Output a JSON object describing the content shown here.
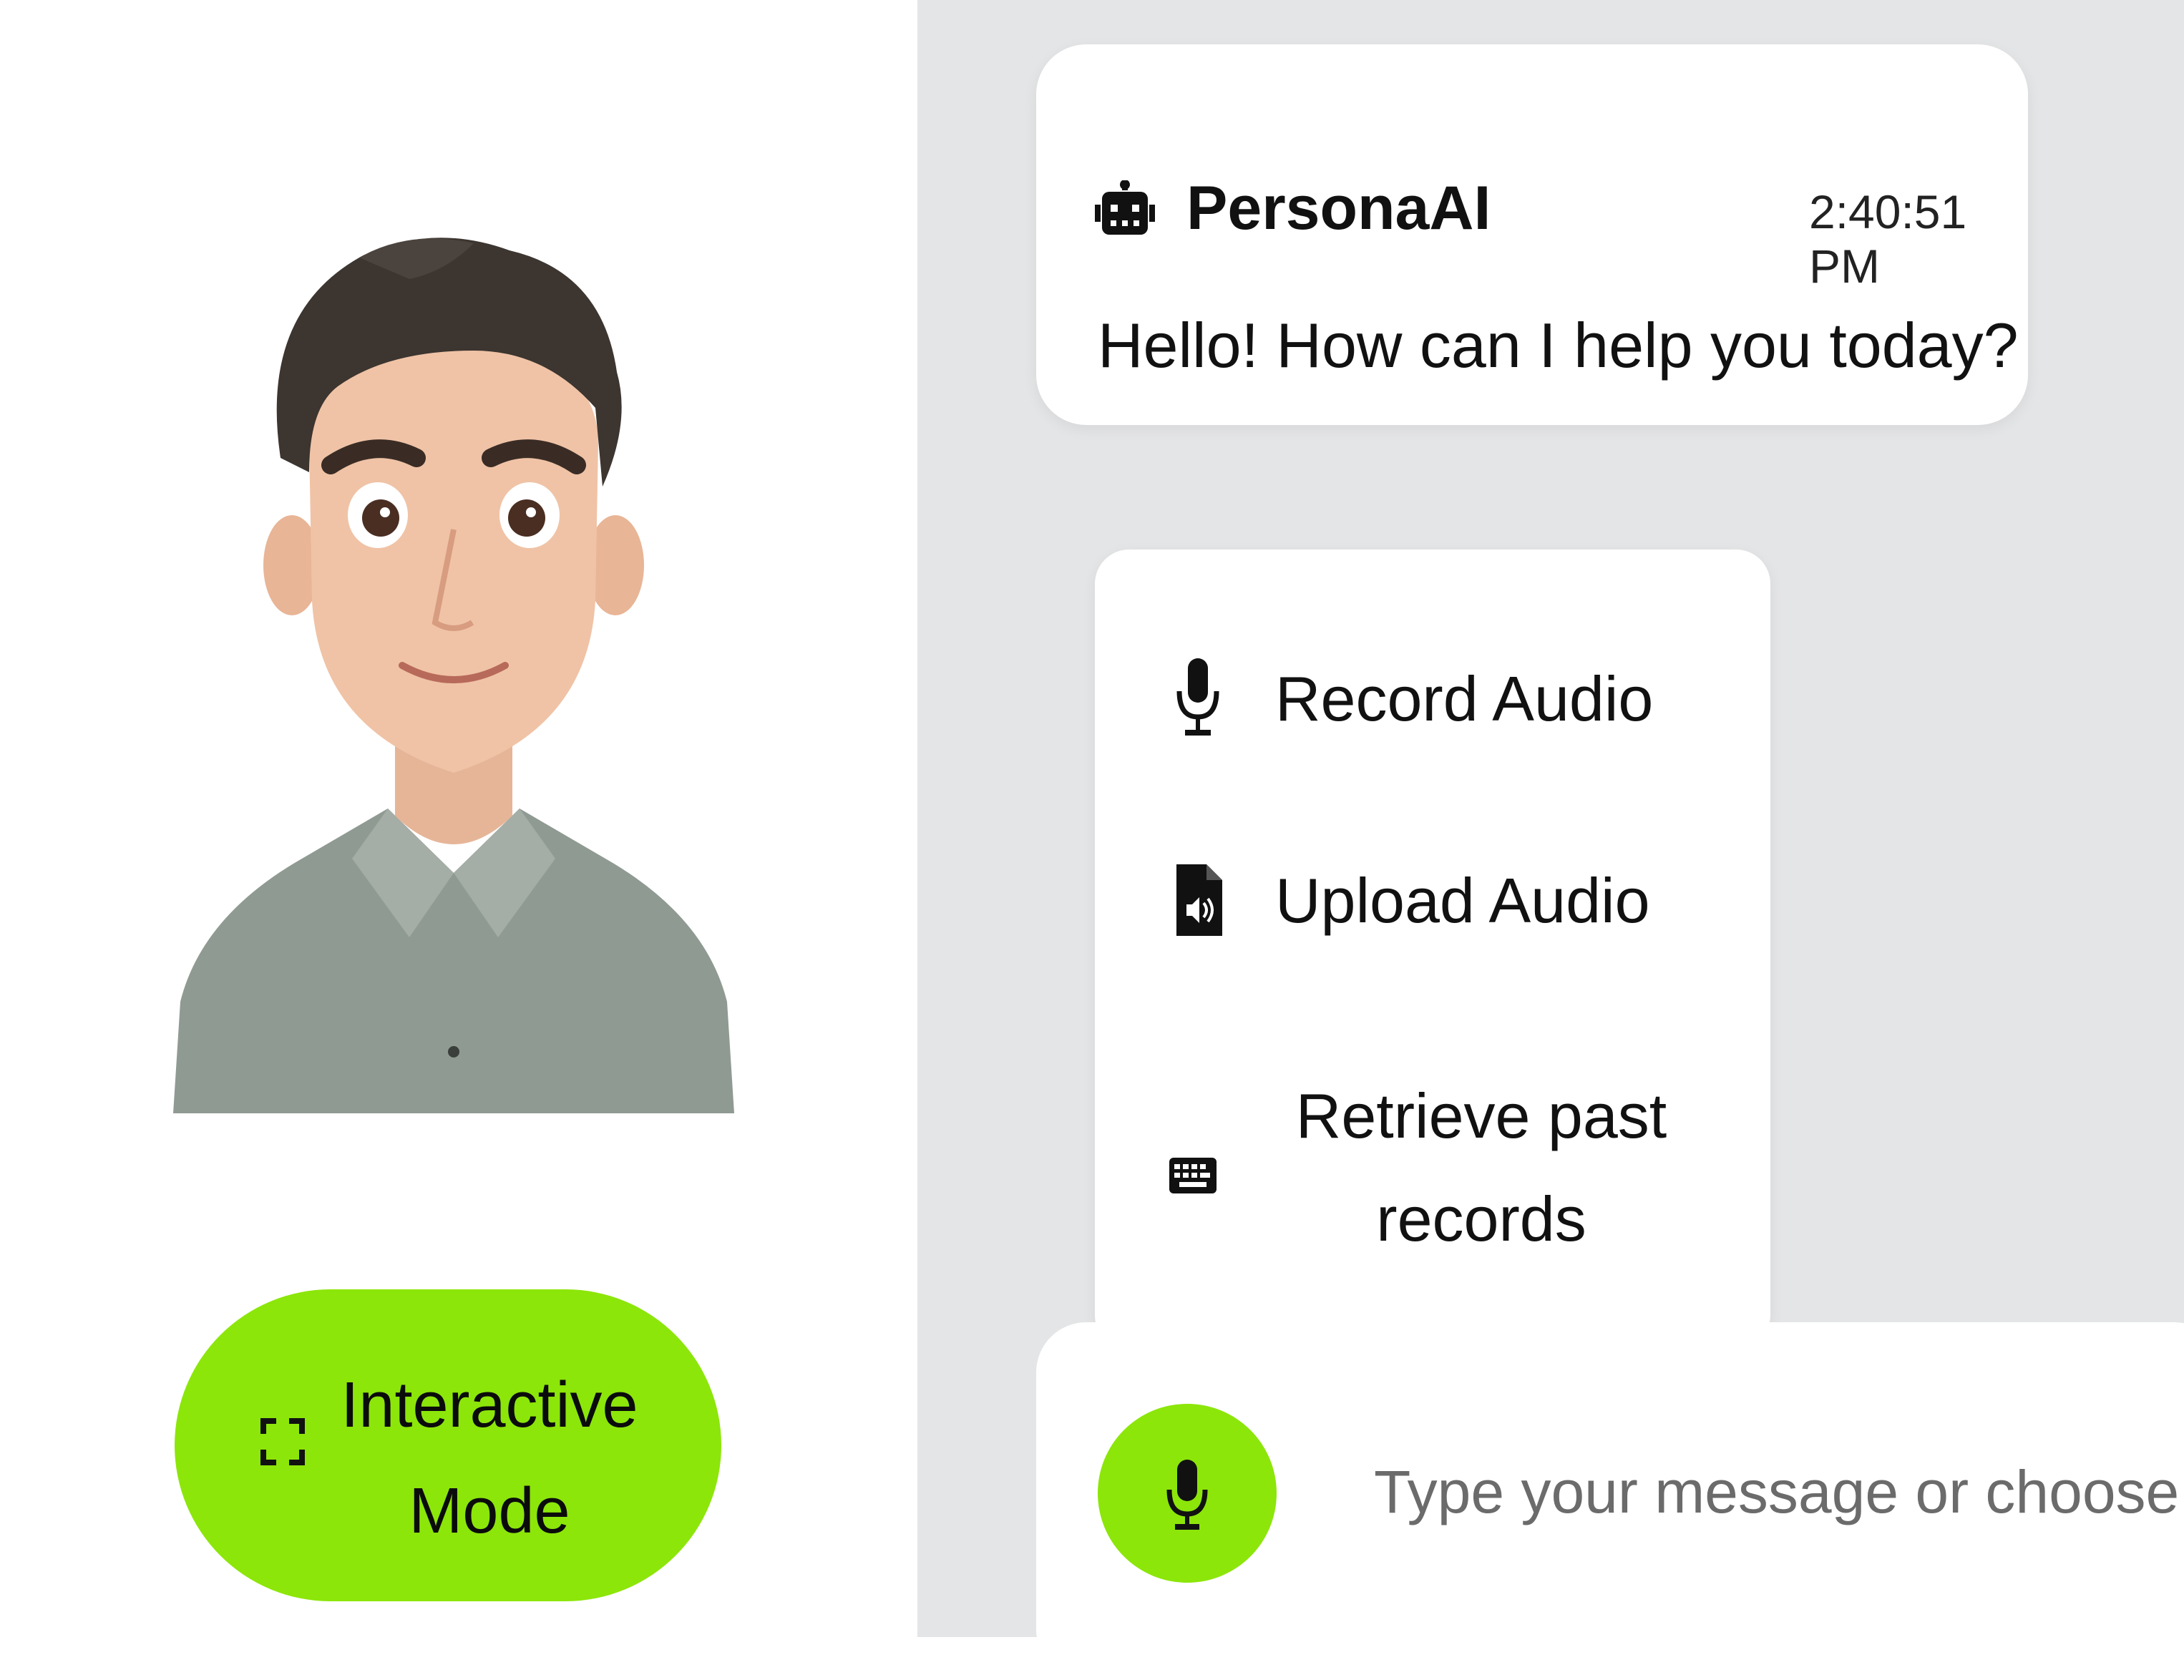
{
  "avatar": {
    "description_icon": "avatar-illustration"
  },
  "interactive_mode": {
    "label_line1": "Interactive",
    "label_line2": "Mode",
    "icon": "fullscreen-icon"
  },
  "chat": {
    "greeting": {
      "sender": "PersonaAI",
      "timestamp": "2:40:51 PM",
      "message": "Hello! How can I help you today?",
      "icon": "robot-icon"
    }
  },
  "options_menu": {
    "items": [
      {
        "label": "Record Audio",
        "icon": "microphone-icon"
      },
      {
        "label": "Upload Audio",
        "icon": "audio-file-icon"
      },
      {
        "label_line1": "Retrieve past",
        "label_line2": "records",
        "icon": "keyboard-icon"
      }
    ]
  },
  "composer": {
    "placeholder": "Type your message or choose",
    "mic_icon": "microphone-icon"
  },
  "colors": {
    "accent": "#8ce60a",
    "panel": "#e4e5e6",
    "bubble": "#ffffff"
  }
}
